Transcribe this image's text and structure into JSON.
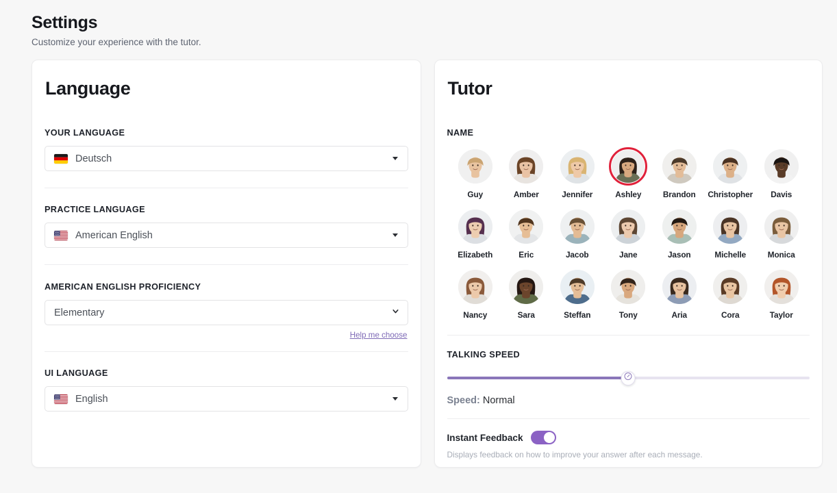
{
  "page": {
    "title": "Settings",
    "subtitle": "Customize your experience with the tutor."
  },
  "colors": {
    "page_background": "#f7f7f7",
    "card_background": "#ffffff",
    "accent_purple": "#8a76b9",
    "toggle_on": "#8b62c4",
    "selected_ring": "#e0213a",
    "link_purple": "#7e6ab6",
    "muted_text": "#a8adb7"
  },
  "language_card": {
    "title": "Language",
    "your_language": {
      "label": "YOUR LANGUAGE",
      "value": "Deutsch",
      "flag": "flag-germany",
      "caret_icon": "caret-down-icon"
    },
    "practice_language": {
      "label": "PRACTICE LANGUAGE",
      "value": "American English",
      "flag": "flag-usa",
      "caret_icon": "caret-down-icon"
    },
    "proficiency": {
      "label": "AMERICAN ENGLISH PROFICIENCY",
      "value": "Elementary",
      "caret_icon": "chevron-down-icon",
      "options": [
        "Elementary"
      ],
      "help_link": "Help me choose"
    },
    "ui_language": {
      "label": "UI LANGUAGE",
      "value": "English",
      "flag": "flag-usa",
      "caret_icon": "caret-down-icon"
    }
  },
  "tutor_card": {
    "title": "Tutor",
    "name_label": "NAME",
    "selected_tutor": "Ashley",
    "tutors": [
      {
        "name": "Guy",
        "selected": false,
        "skin": "#e8c3a0",
        "hair": "#caa472",
        "shirt": "#f0f0f0",
        "bg": "#f0f0f0",
        "gender": "m"
      },
      {
        "name": "Amber",
        "selected": false,
        "skin": "#e9c2a4",
        "hair": "#6b4427",
        "shirt": "#e8e4e0",
        "bg": "#efeeee",
        "gender": "f"
      },
      {
        "name": "Jennifer",
        "selected": false,
        "skin": "#eec9a8",
        "hair": "#d9b472",
        "shirt": "#dfe3e6",
        "bg": "#eceff1",
        "gender": "f"
      },
      {
        "name": "Ashley",
        "selected": true,
        "skin": "#d8a87f",
        "hair": "#2e2119",
        "shirt": "#6a6f56",
        "bg": "#efefef",
        "gender": "f"
      },
      {
        "name": "Brandon",
        "selected": false,
        "skin": "#e3bc98",
        "hair": "#4c3a2a",
        "shirt": "#cfc9bf",
        "bg": "#f0efed",
        "gender": "m"
      },
      {
        "name": "Christopher",
        "selected": false,
        "skin": "#dcb088",
        "hair": "#4a3222",
        "shirt": "#dfe2e5",
        "bg": "#eef0f1",
        "gender": "m"
      },
      {
        "name": "Davis",
        "selected": false,
        "skin": "#5a3c28",
        "hair": "#1b1512",
        "shirt": "#f2f2f2",
        "bg": "#f0f0f0",
        "gender": "m"
      },
      {
        "name": "Elizabeth",
        "selected": false,
        "skin": "#edcdb0",
        "hair": "#56304f",
        "shirt": "#dcdfe3",
        "bg": "#eceef0",
        "gender": "f"
      },
      {
        "name": "Eric",
        "selected": false,
        "skin": "#e6be96",
        "hair": "#51361f",
        "shirt": "#e3e5e7",
        "bg": "#f0f1f1",
        "gender": "m"
      },
      {
        "name": "Jacob",
        "selected": false,
        "skin": "#e3bb94",
        "hair": "#6a5136",
        "shirt": "#9bb3bb",
        "bg": "#eef0f1",
        "gender": "m"
      },
      {
        "name": "Jane",
        "selected": false,
        "skin": "#eccaae",
        "hair": "#5d4633",
        "shirt": "#cdd3d8",
        "bg": "#edeff0",
        "gender": "f"
      },
      {
        "name": "Jason",
        "selected": false,
        "skin": "#d7a77d",
        "hair": "#241a13",
        "shirt": "#a9bfb6",
        "bg": "#eef0ef",
        "gender": "m"
      },
      {
        "name": "Michelle",
        "selected": false,
        "skin": "#e8c4a3",
        "hair": "#4b3526",
        "shirt": "#93a9c2",
        "bg": "#edeef0",
        "gender": "f"
      },
      {
        "name": "Monica",
        "selected": false,
        "skin": "#e9c5a4",
        "hair": "#7b5d3c",
        "shirt": "#d7d9db",
        "bg": "#efefef",
        "gender": "f"
      },
      {
        "name": "Nancy",
        "selected": false,
        "skin": "#ecc9aa",
        "hair": "#8a5a3b",
        "shirt": "#e0dcd6",
        "bg": "#f1efed",
        "gender": "f"
      },
      {
        "name": "Sara",
        "selected": false,
        "skin": "#6b452c",
        "hair": "#241712",
        "shirt": "#5f6b47",
        "bg": "#efeeec",
        "gender": "f"
      },
      {
        "name": "Steffan",
        "selected": false,
        "skin": "#e4bd97",
        "hair": "#4e3a28",
        "shirt": "#4e6d8c",
        "bg": "#e9eff3",
        "gender": "m"
      },
      {
        "name": "Tony",
        "selected": false,
        "skin": "#d9a87e",
        "hair": "#33241a",
        "shirt": "#e6e3dd",
        "bg": "#efeeec",
        "gender": "m"
      },
      {
        "name": "Aria",
        "selected": false,
        "skin": "#e7c2a0",
        "hair": "#3a2a1e",
        "shirt": "#8d9cb5",
        "bg": "#eceef1",
        "gender": "f"
      },
      {
        "name": "Cora",
        "selected": false,
        "skin": "#e9c5a2",
        "hair": "#5b3c26",
        "shirt": "#ded9d2",
        "bg": "#f0efed",
        "gender": "f"
      },
      {
        "name": "Taylor",
        "selected": false,
        "skin": "#f0cdae",
        "hair": "#b3562a",
        "shirt": "#e4e0db",
        "bg": "#f1efed",
        "gender": "f"
      }
    ],
    "talking_speed": {
      "label": "TALKING SPEED",
      "thumb_icon": "speedometer-icon",
      "percent": 50,
      "speed_key": "Speed:",
      "speed_value": "Normal"
    },
    "instant_feedback": {
      "label": "Instant Feedback",
      "enabled": true,
      "description": "Displays feedback on how to improve your answer after each message."
    }
  }
}
